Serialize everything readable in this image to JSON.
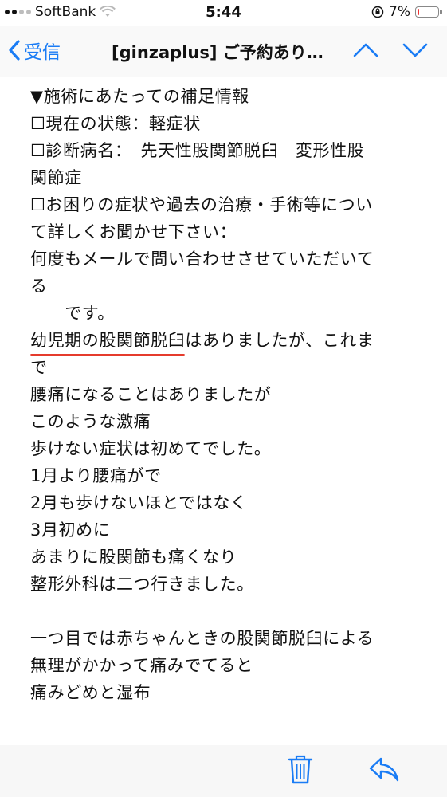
{
  "status_bar": {
    "carrier": "SoftBank",
    "time": "5:44",
    "battery": "7%",
    "battery_level": 0.07
  },
  "nav": {
    "back_label": "受信",
    "title": "[ginzaplus] ご予約あり…"
  },
  "email_body": {
    "lines": [
      "▼施術にあたっての補足情報",
      "☐現在の状態：軽症状",
      "☐診断病名：　先天性股関節脱臼　変形性股",
      "関節症",
      "☐お困りの症状や過去の治療・手術等につい",
      "て詳しくお聞かせ下さい：",
      "何度もメールで問い合わせさせていただいて",
      "る",
      "　　です。",
      "",
      "で",
      "腰痛になることはありましたが",
      "このような激痛",
      "歩けない症状は初めてでした。",
      "1月より腰痛がで",
      "2月も歩けないほとではなく",
      "3月初めに",
      "あまりに股関節も痛くなり",
      "整形外科は二つ行きました。",
      "",
      "一つ目では赤ちゃんときの股関節脱臼による",
      "無理がかかって痛みでてると",
      "痛みどめと湿布"
    ],
    "highlight_line": {
      "underlined_text": "幼児期の股関節脱臼",
      "rest_text": "はありましたが、これま"
    },
    "underline_color": "#e53b2c"
  },
  "colors": {
    "accent": "#1a7cf5"
  },
  "toolbar": {
    "icons": [
      "trash-icon",
      "reply-icon"
    ]
  }
}
